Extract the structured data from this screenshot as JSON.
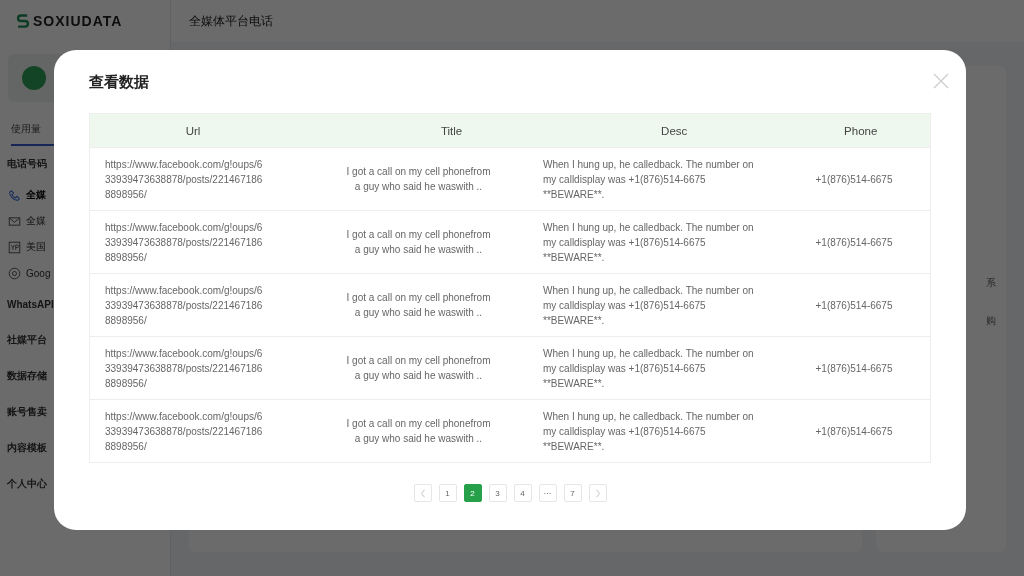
{
  "logo": {
    "text": "SOXIUDATA"
  },
  "header": {
    "title": "全媒体平台电话"
  },
  "sidebar": {
    "tab": "使用量",
    "items": [
      {
        "label": "电话号码",
        "kind": "group",
        "selected": false
      },
      {
        "label": "全媒",
        "kind": "sub",
        "selected": true
      },
      {
        "label": "全媒",
        "kind": "sub",
        "selected": false
      },
      {
        "label": "美国",
        "kind": "sub",
        "selected": false
      },
      {
        "label": "Goog",
        "kind": "sub",
        "selected": false
      },
      {
        "label": "WhatsAPI",
        "kind": "group",
        "selected": false
      },
      {
        "label": "社媒平台",
        "kind": "group",
        "selected": false
      },
      {
        "label": "数据存储",
        "kind": "group",
        "selected": false
      },
      {
        "label": "账号售卖",
        "kind": "group",
        "selected": false
      },
      {
        "label": "内容模板",
        "kind": "group",
        "selected": false
      },
      {
        "label": "个人中心",
        "kind": "group",
        "selected": false
      }
    ]
  },
  "right_panel": {
    "texts": [
      "系",
      "购"
    ]
  },
  "dialog": {
    "title": "查看数据",
    "table": {
      "columns": [
        "Url",
        "Title",
        "Desc",
        "Phone"
      ],
      "rows": [
        [
          "https://www.facebook.com/g!oups/633939473638878/posts/2214671868898956/",
          "I got a call on my cell phonefrom a guy who said he waswith ..",
          "When I hung up, he calledback. The number on my calldisplay was +1(876)514-6675 **BEWARE**.",
          "+1(876)514-6675"
        ],
        [
          "https://www.facebook.com/g!oups/633939473638878/posts/2214671868898956/",
          "I got a call on my cell phonefrom a guy who said he waswith ..",
          "When I hung up, he calledback. The number on my calldisplay was +1(876)514-6675 **BEWARE**.",
          "+1(876)514-6675"
        ],
        [
          "https://www.facebook.com/g!oups/633939473638878/posts/2214671868898956/",
          "I got a call on my cell phonefrom a guy who said he waswith ..",
          "When I hung up, he calledback. The number on my calldisplay was +1(876)514-6675 **BEWARE**.",
          "+1(876)514-6675"
        ],
        [
          "https://www.facebook.com/g!oups/633939473638878/posts/2214671868898956/",
          "I got a call on my cell phonefrom a guy who said he waswith ..",
          "When I hung up, he calledback. The number on my calldisplay was +1(876)514-6675 **BEWARE**.",
          "+1(876)514-6675"
        ],
        [
          "https://www.facebook.com/g!oups/633939473638878/posts/2214671868898956/",
          "I got a call on my cell phonefrom a guy who said he waswith ..",
          "When I hung up, he calledback. The number on my calldisplay was +1(876)514-6675 **BEWARE**.",
          "+1(876)514-6675"
        ]
      ]
    },
    "pagination": [
      {
        "label": "1",
        "selected": false
      },
      {
        "label": "2",
        "selected": true
      },
      {
        "label": "3",
        "selected": false
      },
      {
        "label": "4",
        "selected": false
      },
      {
        "label": "···",
        "selected": false
      },
      {
        "label": "7",
        "selected": false
      }
    ]
  }
}
